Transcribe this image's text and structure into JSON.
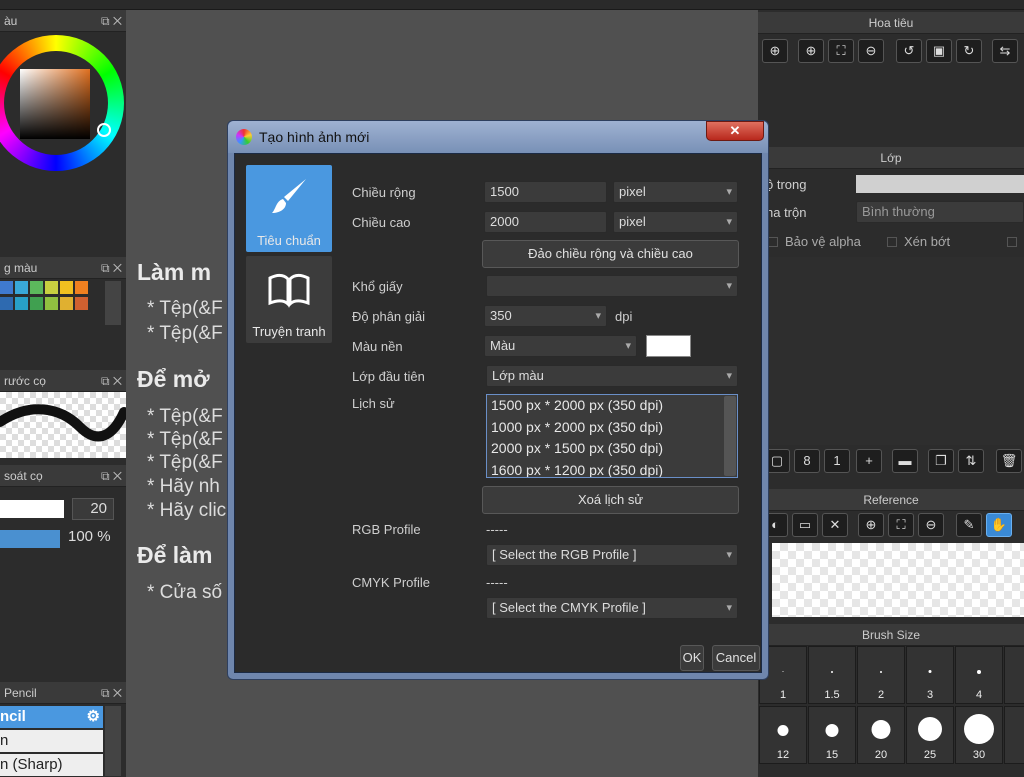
{
  "left_panels": {
    "color_title": "àu",
    "swatch_title": "g màu",
    "brush_preview_title": "rước cọ",
    "brush_control_title": "soát cọ",
    "brush_size_value": "20",
    "opacity_value": "100 %",
    "brush_list_title": "Pencil",
    "brush_list_items": [
      "ncil",
      "n",
      "n (Sharp)"
    ]
  },
  "canvas_text": {
    "heading1": "Làm m",
    "lines1": [
      "* Tệp(&F",
      "* Tệp(&F"
    ],
    "heading2": "Để mở",
    "lines2": [
      "* Tệp(&F",
      "* Tệp(&F",
      "* Tệp(&F",
      "* Hãy nh",
      "* Hãy clic"
    ],
    "heading3": "Để làm",
    "lines3": [
      "* Cửa số"
    ]
  },
  "right_panels": {
    "navigator_title": "Hoa tiêu",
    "layer_title": "Lớp",
    "opacity_label": "ộ trong",
    "blend_label": "ha trộn",
    "blend_value": "Bình thường",
    "protect_alpha": "Bảo vệ alpha",
    "clipping": "Xén bớt",
    "reference_title": "Reference",
    "brush_size_title": "Brush Size",
    "brush_sizes": [
      "1",
      "1.5",
      "2",
      "3",
      "4",
      "12",
      "15",
      "20",
      "25",
      "30"
    ]
  },
  "dialog": {
    "title": "Tạo hình ảnh mới",
    "close_label": "✕",
    "categories": [
      {
        "label": "Tiêu chuẩn",
        "icon": "brush-icon",
        "selected": true
      },
      {
        "label": "Truyện tranh",
        "icon": "book-icon",
        "selected": false
      }
    ],
    "width_label": "Chiều rộng",
    "width_value": "1500",
    "width_unit": "pixel",
    "height_label": "Chiều cao",
    "height_value": "2000",
    "height_unit": "pixel",
    "swap_button": "Đảo chiều rộng và chiều cao",
    "paper_label": "Khổ giấy",
    "paper_value": "",
    "resolution_label": "Độ phân giải",
    "resolution_value": "350",
    "resolution_unit": "dpi",
    "bg_label": "Màu nền",
    "bg_value": "Màu",
    "bg_color": "#ffffff",
    "first_layer_label": "Lớp đầu tiên",
    "first_layer_value": "Lớp màu",
    "history_label": "Lịch sử",
    "history_items": [
      "1500 px * 2000 px (350 dpi)",
      "1000 px * 2000 px (350 dpi)",
      "2000 px * 1500 px (350 dpi)",
      "1600 px * 1200 px (350 dpi)"
    ],
    "clear_history_button": "Xoá lịch sử",
    "rgb_label": "RGB Profile",
    "rgb_value": "-----",
    "rgb_select": "[ Select the RGB Profile ]",
    "cmyk_label": "CMYK Profile",
    "cmyk_value": "-----",
    "cmyk_select": "[ Select the CMYK Profile ]",
    "ok_button": "OK",
    "cancel_button": "Cancel"
  },
  "colors": {
    "accent": "#3a8ad6",
    "panel_bg": "#2c2c2c",
    "dialog_frame": "#6f86ad"
  }
}
